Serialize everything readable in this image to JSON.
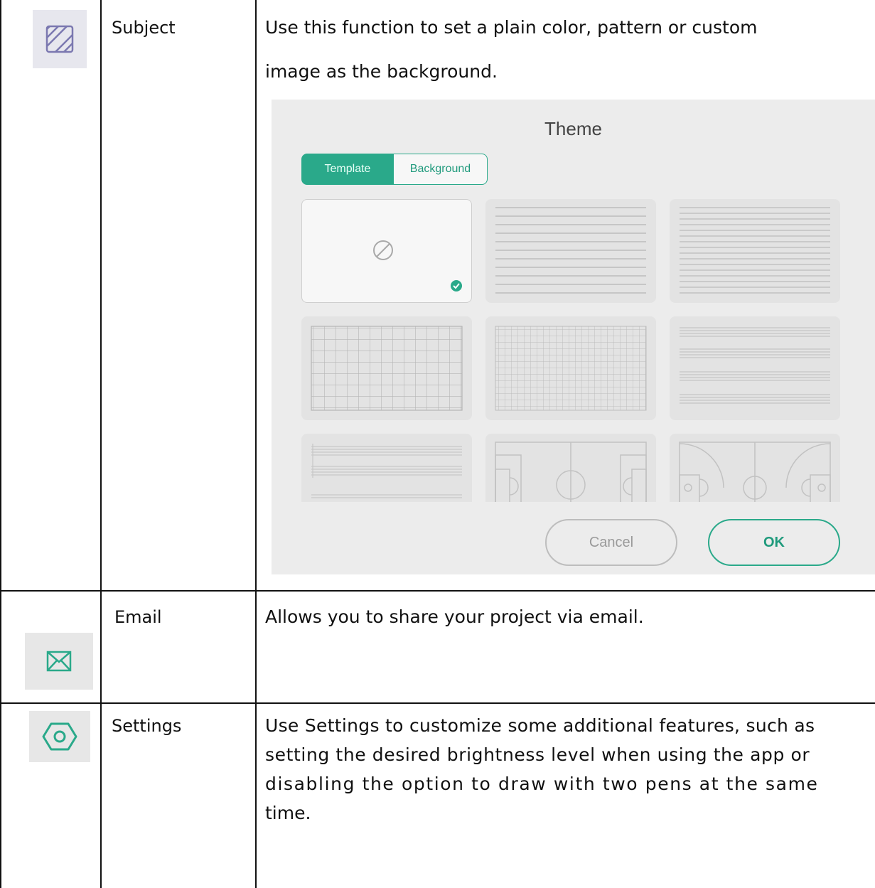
{
  "rows": [
    {
      "icon": "hatched-square-icon",
      "name": "Subject",
      "description_line1": "Use this function to set a plain color, pattern or custom",
      "description_line2": "image as the background."
    },
    {
      "icon": "envelope-icon",
      "name": "Email",
      "description": "Allows you to share your project via email."
    },
    {
      "icon": "hexagon-settings-icon",
      "name": "Settings",
      "description_lines": [
        "Use Settings to customize some additional features, such as",
        "setting the desired brightness level when using the app or",
        "disabling the option to draw with two pens at the same",
        "time."
      ]
    }
  ],
  "theme_dialog": {
    "title": "Theme",
    "tabs": [
      "Template",
      "Background"
    ],
    "active_tab": "Template",
    "templates": [
      "none",
      "lined",
      "lined-narrow",
      "grid",
      "grid-fine",
      "staff",
      "music-staff",
      "football-field",
      "basketball-court"
    ],
    "selected_template": "none",
    "cancel_label": "Cancel",
    "ok_label": "OK",
    "accent_color": "#2aa98a"
  }
}
